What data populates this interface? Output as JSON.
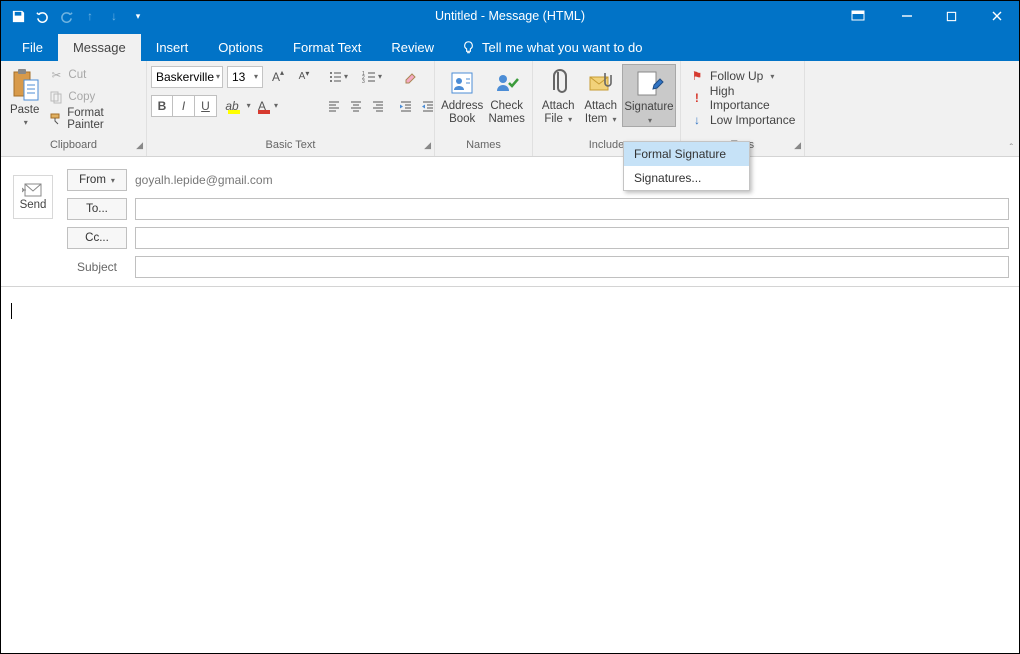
{
  "window": {
    "title": "Untitled  -  Message (HTML)"
  },
  "tabs": {
    "file": "File",
    "message": "Message",
    "insert": "Insert",
    "options": "Options",
    "format_text": "Format Text",
    "review": "Review",
    "tellme": "Tell me what you want to do"
  },
  "ribbon": {
    "clipboard": {
      "label": "Clipboard",
      "paste": "Paste",
      "cut": "Cut",
      "copy": "Copy",
      "format_painter": "Format Painter"
    },
    "basic_text": {
      "label": "Basic Text",
      "font_name": "Baskerville",
      "font_size": "13"
    },
    "names": {
      "label": "Names",
      "address_book": "Address\nBook",
      "check_names": "Check\nNames"
    },
    "include": {
      "label": "Include",
      "attach_file": "Attach\nFile",
      "attach_item": "Attach\nItem",
      "signature": "Signature"
    },
    "tags": {
      "label": "Tags",
      "followup": "Follow Up",
      "high": "High Importance",
      "low": "Low Importance"
    }
  },
  "signature_menu": {
    "formal": "Formal Signature",
    "signatures": "Signatures..."
  },
  "compose": {
    "send": "Send",
    "from_label": "From",
    "from_value": "goyalh.lepide@gmail.com",
    "to": "To...",
    "cc": "Cc...",
    "subject": "Subject"
  }
}
